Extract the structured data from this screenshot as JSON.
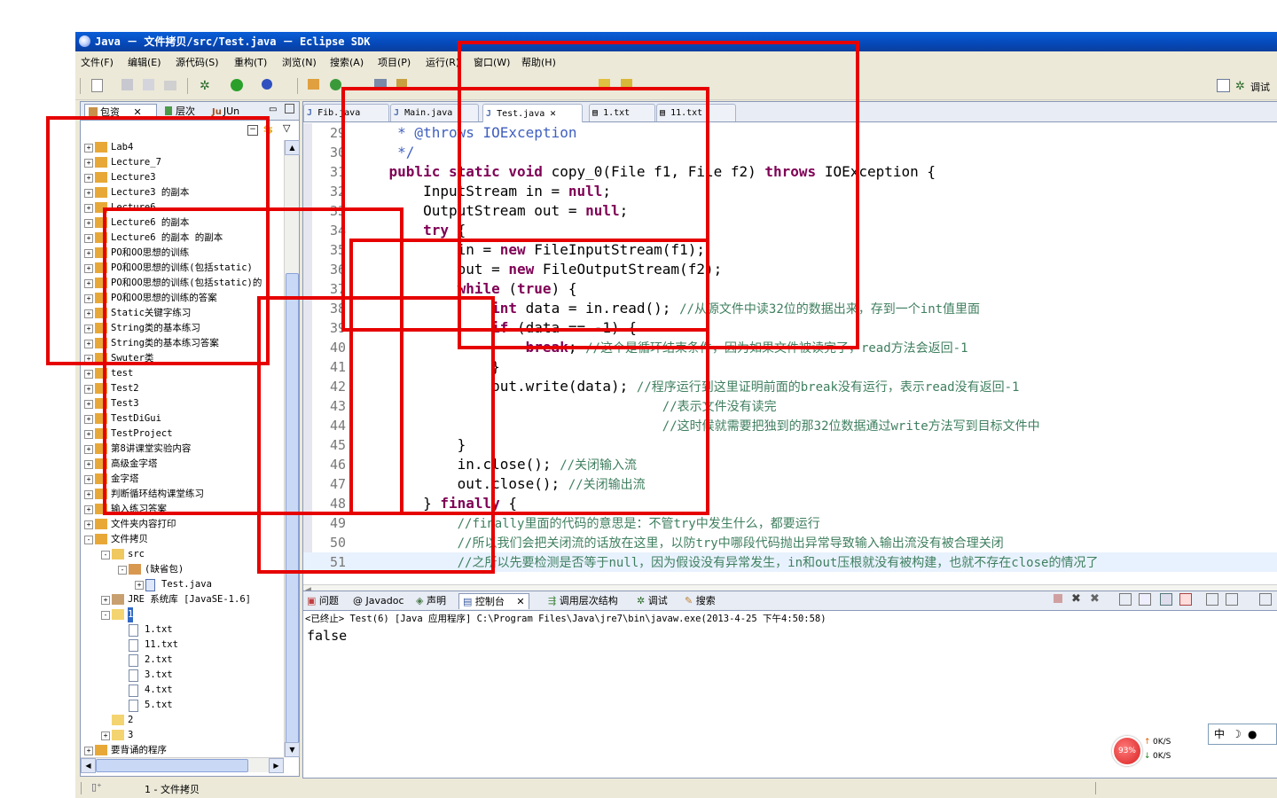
{
  "window": {
    "title": "Java － 文件拷贝/src/Test.java － Eclipse SDK"
  },
  "menu": [
    "文件(F)",
    "编辑(E)",
    "源代码(S)",
    "重构(T)",
    "浏览(N)",
    "搜索(A)",
    "项目(P)",
    "运行(R)",
    "窗口(W)",
    "帮助(H)"
  ],
  "toolbar": {
    "right_label": "调试"
  },
  "left_panel": {
    "tabs": [
      "包资",
      "层次",
      "JUn"
    ],
    "tree": [
      {
        "label": "Lab4",
        "level": 0,
        "exp": "+"
      },
      {
        "label": "Lecture_7",
        "level": 0,
        "exp": "+"
      },
      {
        "label": "Lecture3",
        "level": 0,
        "exp": "+"
      },
      {
        "label": "Lecture3 的副本",
        "level": 0,
        "exp": "+"
      },
      {
        "label": "Lecture6",
        "level": 0,
        "exp": "+"
      },
      {
        "label": "Lecture6 的副本",
        "level": 0,
        "exp": "+"
      },
      {
        "label": "Lecture6 的副本 的副本",
        "level": 0,
        "exp": "+"
      },
      {
        "label": "PO和OO思想的训练",
        "level": 0,
        "exp": "+"
      },
      {
        "label": "PO和OO思想的训练(包括static)",
        "level": 0,
        "exp": "+"
      },
      {
        "label": "PO和OO思想的训练(包括static)的",
        "level": 0,
        "exp": "+"
      },
      {
        "label": "PO和OO思想的训练的答案",
        "level": 0,
        "exp": "+"
      },
      {
        "label": "Static关键字练习",
        "level": 0,
        "exp": "+"
      },
      {
        "label": "String类的基本练习",
        "level": 0,
        "exp": "+"
      },
      {
        "label": "String类的基本练习答案",
        "level": 0,
        "exp": "+"
      },
      {
        "label": "Swuter类",
        "level": 0,
        "exp": "+"
      },
      {
        "label": "test",
        "level": 0,
        "exp": "+"
      },
      {
        "label": "Test2",
        "level": 0,
        "exp": "+"
      },
      {
        "label": "Test3",
        "level": 0,
        "exp": "+"
      },
      {
        "label": "TestDiGui",
        "level": 0,
        "exp": "+"
      },
      {
        "label": "TestProject",
        "level": 0,
        "exp": "+"
      },
      {
        "label": "第8讲课堂实验内容",
        "level": 0,
        "exp": "+"
      },
      {
        "label": "高级金字塔",
        "level": 0,
        "exp": "+"
      },
      {
        "label": "金字塔",
        "level": 0,
        "exp": "+"
      },
      {
        "label": "判断循环结构课堂练习",
        "level": 0,
        "exp": "+"
      },
      {
        "label": "输入练习答案",
        "level": 0,
        "exp": "+"
      },
      {
        "label": "文件夹内容打印",
        "level": 0,
        "exp": "+"
      },
      {
        "label": "文件拷贝",
        "level": 0,
        "exp": "-"
      },
      {
        "label": "src",
        "level": 1,
        "exp": "-"
      },
      {
        "label": "(缺省包)",
        "level": 2,
        "exp": "-"
      },
      {
        "label": "Test.java",
        "level": 3,
        "exp": "+"
      },
      {
        "label": "JRE 系统库 [JavaSE-1.6]",
        "level": 1,
        "exp": "+"
      },
      {
        "label": "1",
        "level": 1,
        "exp": "-"
      },
      {
        "label": "1.txt",
        "level": 2,
        "exp": ""
      },
      {
        "label": "11.txt",
        "level": 2,
        "exp": ""
      },
      {
        "label": "2.txt",
        "level": 2,
        "exp": ""
      },
      {
        "label": "3.txt",
        "level": 2,
        "exp": ""
      },
      {
        "label": "4.txt",
        "level": 2,
        "exp": ""
      },
      {
        "label": "5.txt",
        "level": 2,
        "exp": ""
      },
      {
        "label": "2",
        "level": 1,
        "exp": ""
      },
      {
        "label": "3",
        "level": 1,
        "exp": "+"
      },
      {
        "label": "要背诵的程序",
        "level": 0,
        "exp": "+"
      }
    ]
  },
  "editor": {
    "tabs": [
      "Fib.java",
      "Main.java",
      "Test.java",
      "1.txt",
      "11.txt"
    ],
    "active_tab": "Test.java",
    "lines": [
      {
        "n": "29",
        "t": "     * @throws IOException"
      },
      {
        "n": "30",
        "t": "     */"
      },
      {
        "n": "31",
        "t": "    public static void copy_0(File f1, File f2) throws IOException {"
      },
      {
        "n": "32",
        "t": "        InputStream in = null;"
      },
      {
        "n": "33",
        "t": "        OutputStream out = null;"
      },
      {
        "n": "34",
        "t": "        try {"
      },
      {
        "n": "35",
        "t": "            in = new FileInputStream(f1);"
      },
      {
        "n": "36",
        "t": "            out = new FileOutputStream(f2);"
      },
      {
        "n": "37",
        "t": "            while (true) {"
      },
      {
        "n": "38",
        "t": "                int data = in.read(); //从源文件中读32位的数据出来，存到一个int值里面"
      },
      {
        "n": "39",
        "t": "                if (data == -1) {"
      },
      {
        "n": "40",
        "t": "                    break; //这个是循环结束条件，因为如果文件被读完了，read方法会返回-1"
      },
      {
        "n": "41",
        "t": "                }"
      },
      {
        "n": "42",
        "t": "                out.write(data); //程序运行到这里证明前面的break没有运行，表示read没有返回-1"
      },
      {
        "n": "43",
        "t": "                                    //表示文件没有读完"
      },
      {
        "n": "44",
        "t": "                                    //这时候就需要把独到的那32位数据通过write方法写到目标文件中"
      },
      {
        "n": "45",
        "t": "            }"
      },
      {
        "n": "46",
        "t": "            in.close(); //关闭输入流"
      },
      {
        "n": "47",
        "t": "            out.close(); //关闭输出流"
      },
      {
        "n": "48",
        "t": "        } finally {"
      },
      {
        "n": "49",
        "t": "            //finally里面的代码的意思是：不管try中发生什么，都要运行"
      },
      {
        "n": "50",
        "t": "            //所以我们会把关闭流的话放在这里，以防try中哪段代码抛出异常导致输入输出流没有被合理关闭"
      },
      {
        "n": "51",
        "t": "            //之所以先要检测是否等于null，因为假设没有异常发生，in和out压根就没有被构建，也就不存在close的情况了"
      }
    ]
  },
  "console": {
    "tabs": [
      "问题",
      "Javadoc",
      "声明",
      "控制台",
      "调用层次结构",
      "调试",
      "搜索"
    ],
    "active_tab": "控制台",
    "header": "<已终止> Test(6) [Java 应用程序] C:\\Program Files\\Java\\jre7\\bin\\javaw.exe(2013-4-25 下午4:50:58)",
    "output": "false"
  },
  "statusbar": {
    "text": "1 - 文件拷贝"
  },
  "netwidget": {
    "percent": "93%",
    "up": "0K/S",
    "down": "0K/S"
  },
  "ime": {
    "label": "中"
  },
  "colors": {
    "keyword": "#7f0055",
    "comment": "#3f7f5f",
    "javadoc": "#3f5fbf",
    "annotation_box": "#e60000",
    "titlebar": "#0548b8"
  }
}
